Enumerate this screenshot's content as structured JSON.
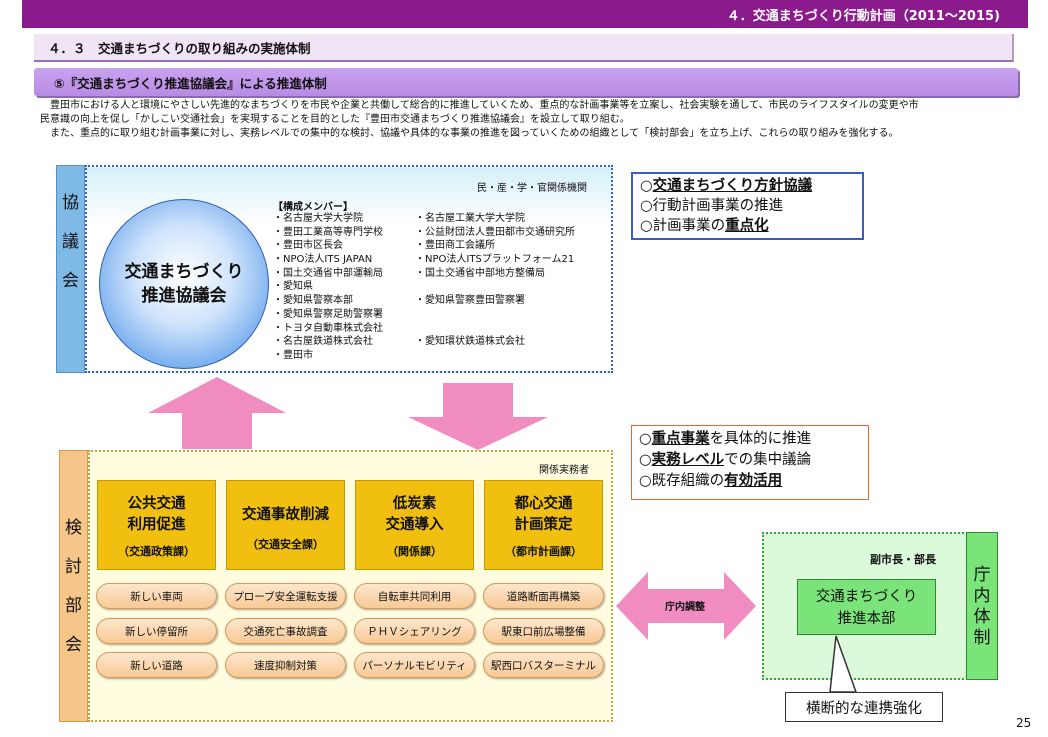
{
  "header": {
    "band_title": "４．交通まちづくり行動計画（2011～2015)"
  },
  "section": {
    "title": "４．３　交通まちづくりの取り組みの実施体制"
  },
  "subsection": {
    "title": "⑤『交通まちづくり推進協議会』による推進体制"
  },
  "intro": {
    "line1": "　豊田市における人と環境にやさしい先進的なまちづくりを市民や企業と共働して総合的に推進していくため、重点的な計画事業等を立案し、社会実験を通して、市民のライフスタイルの変更や市",
    "line2": "民意識の向上を促し「かしこい交通社会」を実現することを目的とした『豊田市交通まちづくり推進協議会』を設立して取り組む。",
    "line3": "　また、重点的に取り組む計画事業に対し、実務レベルでの集中的な検討、協議や具体的な事業の推進を図っていくための組織として「検討部会」を立ち上げ、これらの取り組みを強化する。"
  },
  "council": {
    "tab_chars": [
      "協",
      "議",
      "会"
    ],
    "header": "民・産・学・官関係機関",
    "circle_line1": "交通まちづくり",
    "circle_line2": "推進協議会",
    "members_title": "【構成メンバー】",
    "members": [
      "・名古屋大学大学院",
      "・名古屋工業大学大学院",
      "・豊田工業高等専門学校",
      "・公益財団法人豊田都市交通研究所",
      "・豊田市区長会",
      "・豊田商工会議所",
      "・NPO法人ITS JAPAN",
      "・NPO法人ITSプラットフォーム21",
      "・国土交通省中部運輸局",
      "・国土交通省中部地方整備局",
      "・愛知県",
      "",
      "・愛知県警察本部",
      "・愛知県警察豊田警察署",
      "・愛知県警察足助警察署",
      "",
      "・トヨタ自動車株式会社",
      "",
      "・名古屋鉄道株式会社",
      "・愛知環状鉄道株式会社",
      "・豊田市",
      ""
    ]
  },
  "callout_council": {
    "items": [
      {
        "mark": "○",
        "plain_before": "",
        "bold": "交通まちづくり方針協議",
        "plain_after": ""
      },
      {
        "mark": "○",
        "plain_before": "行動計画事業の推進",
        "bold": "",
        "plain_after": ""
      },
      {
        "mark": "○",
        "plain_before": "計画事業の",
        "bold": "重点化",
        "plain_after": ""
      }
    ]
  },
  "callout_review": {
    "items": [
      {
        "mark": "○",
        "bold": "重点事業",
        "plain": "を具体的に推進"
      },
      {
        "mark": "○",
        "bold": "実務レベル",
        "plain": "での集中議論"
      },
      {
        "mark": "○",
        "prefix": "既存組織の",
        "bold": "有効活用"
      }
    ]
  },
  "review": {
    "tab_chars": [
      "検",
      "討",
      "部",
      "会"
    ],
    "header": "関係実務者",
    "depts": [
      {
        "line1": "公共交通",
        "line2": "利用促進",
        "section": "（交通政策課）"
      },
      {
        "line1": "交通事故削減",
        "line2": "",
        "section": "（交通安全課）"
      },
      {
        "line1": "低炭素",
        "line2": "交通導入",
        "section": "（関係課）"
      },
      {
        "line1": "都心交通",
        "line2": "計画策定",
        "section": "（都市計画課）"
      }
    ],
    "projects": [
      [
        "新しい車両",
        "新しい停留所",
        "新しい道路"
      ],
      [
        "プローブ安全運転支援",
        "交通死亡事故調査",
        "速度抑制対策"
      ],
      [
        "自転車共同利用",
        "ＰＨＶシェアリング",
        "パーソナルモビリティ"
      ],
      [
        "道路断面再構築",
        "駅東口前広場整備",
        "駅西口バスターミナル"
      ]
    ]
  },
  "coordination": {
    "label": "庁内調整"
  },
  "government": {
    "header": "副市長・部長",
    "inner_line1": "交通まちづくり",
    "inner_line2": "推進本部",
    "tab_chars": [
      "庁",
      "内",
      "体",
      "制"
    ]
  },
  "liaison": {
    "label": "横断的な連携強化"
  },
  "page_number": "25",
  "colors": {
    "band": "#8b1a8d",
    "council_tab": "#7fb9e6",
    "review_tab": "#f6c58a",
    "dept_fill": "#f0bf10",
    "gov_fill": "#7ae37a",
    "arrow_pink": "#f08cc0"
  }
}
